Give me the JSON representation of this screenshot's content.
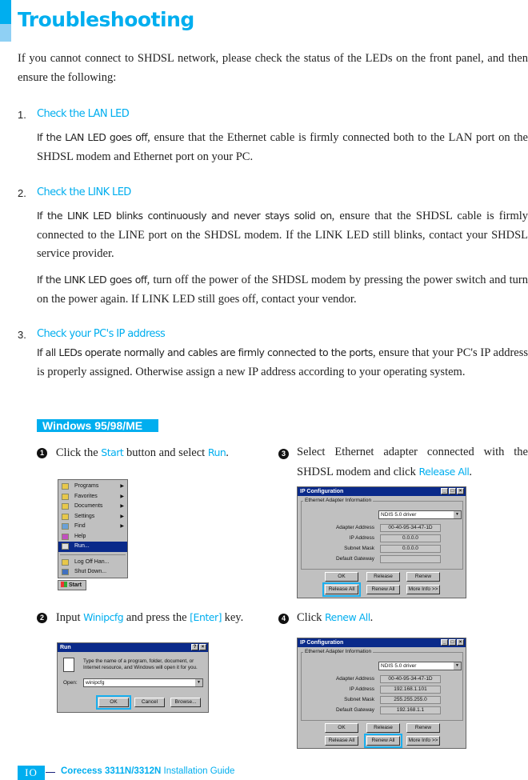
{
  "title": "Troubleshooting",
  "intro": "If you cannot connect to SHDSL network, please check the status of the LEDs on the front panel, and then ensure the following:",
  "items": [
    {
      "num": "1.",
      "heading": "Check the LAN LED",
      "paras": [
        {
          "key": "If the LAN LED goes off",
          "text": ", ensure that the Ethernet cable is firmly connected both to the LAN port on the SHDSL modem and Ethernet port on your PC."
        }
      ]
    },
    {
      "num": "2.",
      "heading": "Check the LINK LED",
      "paras": [
        {
          "key": "If the LINK LED blinks continuously and never stays solid on",
          "text": ", ensure that the SHDSL cable is firmly connected to the LINE port on the SHDSL modem. If the LINK LED still blinks, contact your SHDSL service provider."
        },
        {
          "key": "If the LINK LED goes off",
          "text": ", turn off the power of the SHDSL modem by pressing the power switch and turn on the power again. If LINK LED still goes off, contact your vendor."
        }
      ]
    },
    {
      "num": "3.",
      "heading": "Check your PC's IP address",
      "paras": [
        {
          "key": "If all LEDs operate normally and cables are firmly connected to the ports",
          "text": ", ensure that your PC's IP address is properly assigned. Otherwise assign a new IP address according to your operating system."
        }
      ]
    }
  ],
  "os_label": "Windows 95/98/ME",
  "steps": [
    {
      "bullet": "1",
      "pre": "Click the ",
      "k1": "Start",
      "mid": " button and select ",
      "k2": "Run",
      "post": "."
    },
    {
      "bullet": "2",
      "pre": "Input ",
      "k1": "Winipcfg",
      "mid": " and press the ",
      "k2": "[Enter]",
      "post": " key."
    },
    {
      "bullet": "3",
      "pre": "Select Ethernet adapter connected with the SHDSL modem and click ",
      "k1": "Release All",
      "post": "."
    },
    {
      "bullet": "4",
      "pre": "Click ",
      "k1": "Renew All",
      "post": "."
    }
  ],
  "start_menu": {
    "items": [
      "Programs",
      "Favorites",
      "Documents",
      "Settings",
      "Find",
      "Help",
      "Run...",
      "Log Off Han...",
      "Shut Down..."
    ],
    "start": "Start"
  },
  "run_dialog": {
    "title": "Run",
    "help": "?",
    "close": "×",
    "desc": "Type the name of a program, folder, document, or Internet resource, and Windows will open it for you.",
    "open_label": "Open:",
    "value": "winipcfg",
    "ok": "OK",
    "cancel": "Cancel",
    "browse": "Browse..."
  },
  "ipconfig": [
    {
      "title": "IP Configuration",
      "group": "Ethernet Adapter Information",
      "adapter": "NDIS 5.0 driver",
      "labels": [
        "Adapter Address",
        "IP Address",
        "Subnet Mask",
        "Default Gateway"
      ],
      "values": [
        "00-40-95-34-47-1D",
        "0.0.0.0",
        "0.0.0.0",
        ""
      ],
      "buttons": [
        "OK",
        "Release",
        "Renew",
        "Release All",
        "Renew All",
        "More Info >>"
      ],
      "highlight": "Release All"
    },
    {
      "title": "IP Configuration",
      "group": "Ethernet Adapter Information",
      "adapter": "NDIS 5.0 driver",
      "labels": [
        "Adapter Address",
        "IP Address",
        "Subnet Mask",
        "Default Gateway"
      ],
      "values": [
        "00-40-95-34-47-1D",
        "192.168.1.101",
        "255.255.255.0",
        "192.168.1.1"
      ],
      "buttons": [
        "OK",
        "Release",
        "Renew",
        "Release All",
        "Renew All",
        "More Info >>"
      ],
      "highlight": "Renew All"
    }
  ],
  "footer": {
    "page": "IO",
    "product": "Corecess 3311N/3312N",
    "guide": " Installation Guide"
  },
  "colors": {
    "accent": "#00aeef",
    "light_accent": "#8fd0f4"
  }
}
